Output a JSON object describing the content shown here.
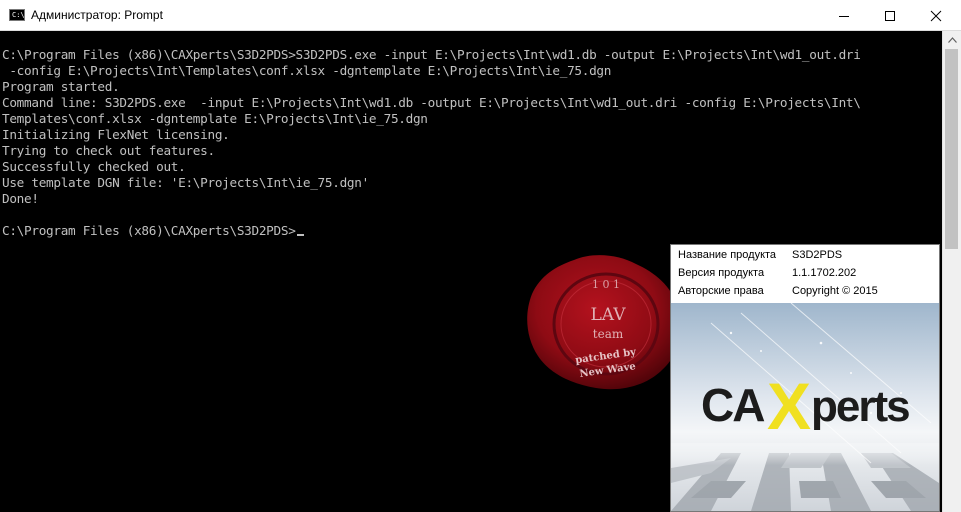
{
  "window": {
    "title": "Администратор: Prompt",
    "icon": "console-icon",
    "icon_text": "C:\\"
  },
  "console": {
    "lines": [
      "",
      "C:\\Program Files (x86)\\CAXperts\\S3D2PDS>S3D2PDS.exe -input E:\\Projects\\Int\\wd1.db -output E:\\Projects\\Int\\wd1_out.dri",
      " -config E:\\Projects\\Int\\Templates\\conf.xlsx -dgntemplate E:\\Projects\\Int\\ie_75.dgn",
      "Program started.",
      "Command line: S3D2PDS.exe  -input E:\\Projects\\Int\\wd1.db -output E:\\Projects\\Int\\wd1_out.dri -config E:\\Projects\\Int\\",
      "Templates\\conf.xlsx -dgntemplate E:\\Projects\\Int\\ie_75.dgn",
      "Initializing FlexNet licensing.",
      "Trying to check out features.",
      "Successfully checked out.",
      "Use template DGN file: 'E:\\Projects\\Int\\ie_75.dgn'",
      "Done!",
      "",
      "C:\\Program Files (x86)\\CAXperts\\S3D2PDS>"
    ],
    "text_color": "#c0c0c0",
    "background": "#000000"
  },
  "seal": {
    "arc_text": "1 0 1",
    "line1": "LAV",
    "line2": "team",
    "line3": "patched by",
    "line4": "New Wave",
    "color": "#8e0b14"
  },
  "splash": {
    "product_label": "Название продукта",
    "product_value": "S3D2PDS",
    "version_label": "Версия продукта",
    "version_value": "1.1.1702.202",
    "copyright_label": "Авторские права",
    "copyright_value": "Copyright ©  2015",
    "logo_ca": "CA",
    "logo_x": "X",
    "logo_perts": "perts",
    "logo_x_color": "#f0e020"
  }
}
